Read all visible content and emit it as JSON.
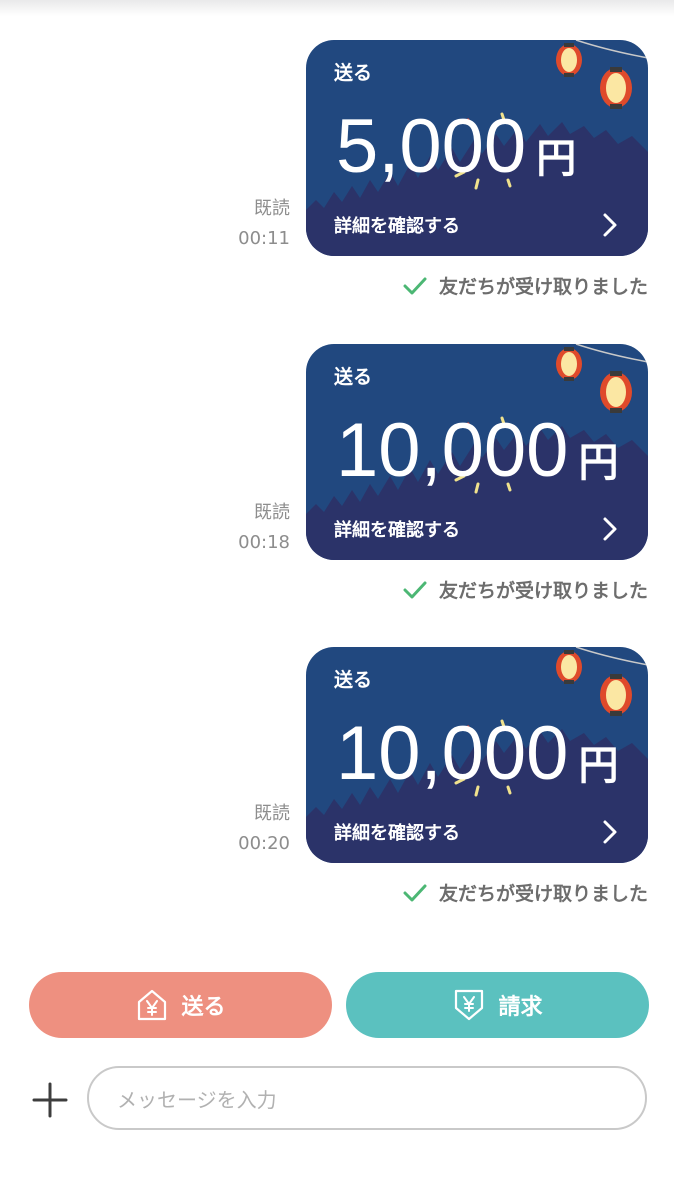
{
  "messages": [
    {
      "read": "既読",
      "time": "00:11",
      "label": "送る",
      "amount": "5,000",
      "currency": "円",
      "detail": "詳細を確認する",
      "status": "友だちが受け取りました"
    },
    {
      "read": "既読",
      "time": "00:18",
      "label": "送る",
      "amount": "10,000",
      "currency": "円",
      "detail": "詳細を確認する",
      "status": "友だちが受け取りました"
    },
    {
      "read": "既読",
      "time": "00:20",
      "label": "送る",
      "amount": "10,000",
      "currency": "円",
      "detail": "詳細を確認する",
      "status": "友だちが受け取りました"
    }
  ],
  "actions": {
    "send_label": "送る",
    "request_label": "請求"
  },
  "composer": {
    "placeholder": "メッセージを入力"
  },
  "icons": {
    "check": "check-icon",
    "chevron": "chevron-right-icon",
    "send": "yen-send-icon",
    "request": "yen-request-icon",
    "plus": "plus-icon",
    "lantern": "lantern-icon"
  },
  "colors": {
    "card_bg": "#21487f",
    "send_button": "#ee9080",
    "request_button": "#5bc1bf",
    "check": "#4cb774"
  }
}
